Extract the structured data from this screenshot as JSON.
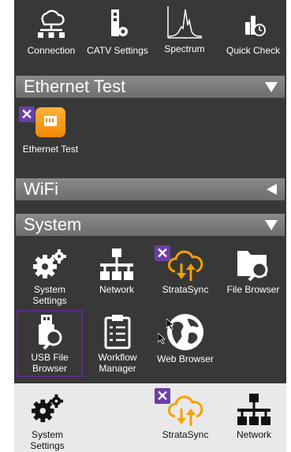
{
  "top_row": {
    "connection": "Connection",
    "catv": "CATV Settings",
    "spectrum": "Spectrum",
    "quick_check": "Quick Check"
  },
  "sections": {
    "ethernet": "Ethernet Test",
    "wifi": "WiFi",
    "system": "System"
  },
  "ethernet_apps": {
    "ethernet_test": "Ethernet Test"
  },
  "system_apps": {
    "system_settings": "System Settings",
    "network": "Network",
    "stratasync": "StrataSync",
    "file_browser": "File Browser",
    "usb_file_browser": "USB File Browser",
    "workflow_manager": "Workflow Manager",
    "web_browser": "Web Browser"
  },
  "dock": {
    "system_settings": "System Settings",
    "stratasync": "StrataSync",
    "network": "Network"
  },
  "badge_glyph": "✕",
  "colors": {
    "accent_orange": "#f5a000",
    "badge_purple": "#6b3fa8",
    "bar_gray": "#7a7a7a"
  }
}
